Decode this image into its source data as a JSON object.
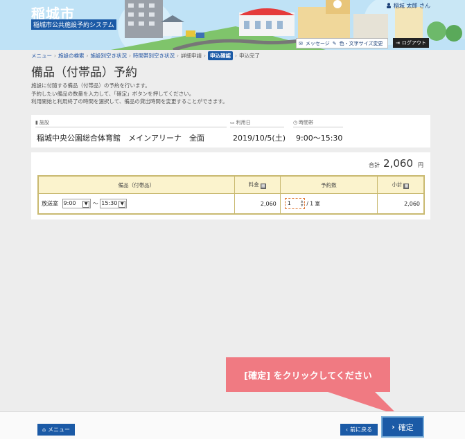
{
  "header": {
    "city_name": "稲城市",
    "system_name": "稲城市公共施設予約システム",
    "user_name": "稲城 太郎 さん",
    "message_label": "メッセージ",
    "text_size_label": "色・文字サイズ変更",
    "logout_label": "ログアウト"
  },
  "breadcrumb": {
    "items": [
      "メニュー",
      "施設の検索",
      "施設別空き状況",
      "時間帯別空き状況"
    ],
    "detail": "詳細申請",
    "current": "申込確認",
    "last": "申込完了"
  },
  "page": {
    "title": "備品（付帯品）予約",
    "desc_1": "施設に付随する備品（付帯品）の予約を行います。",
    "desc_2": "予約したい備品の数量を入力して、「確定」ボタンを押してください。",
    "desc_3": "利用開始と利用終了の時間を選択して、備品の貸出時間を変更することができます。"
  },
  "facility": {
    "facility_label": "施設",
    "facility_value": "稲城中央公園総合体育館　メインアリーナ　全面",
    "date_label": "利用日",
    "date_value": "2019/10/5(土)",
    "time_label": "時間帯",
    "time_value": "9:00～15:30"
  },
  "equipment": {
    "total_label": "合計",
    "total_amount": "2,060",
    "total_unit": "円",
    "headers": {
      "name": "備品（付帯品）",
      "fee": "料金",
      "qty": "予約数",
      "subtotal": "小計"
    },
    "row": {
      "name": "放送室",
      "start_time": "9:00",
      "tilde": "～",
      "end_time": "15:30",
      "fee": "2,060",
      "qty_value": "1",
      "qty_suffix": "/ 1 室",
      "subtotal": "2,060"
    }
  },
  "callout": {
    "text": "[確定] をクリックしてください"
  },
  "footer": {
    "menu_label": "メニュー",
    "prev_label": "前に戻る",
    "ok_label": "確定"
  },
  "colors": {
    "accent": "#1b5aa6",
    "callout": "#f07a82",
    "table_header": "#fbf3cd",
    "table_border": "#c9b970"
  }
}
